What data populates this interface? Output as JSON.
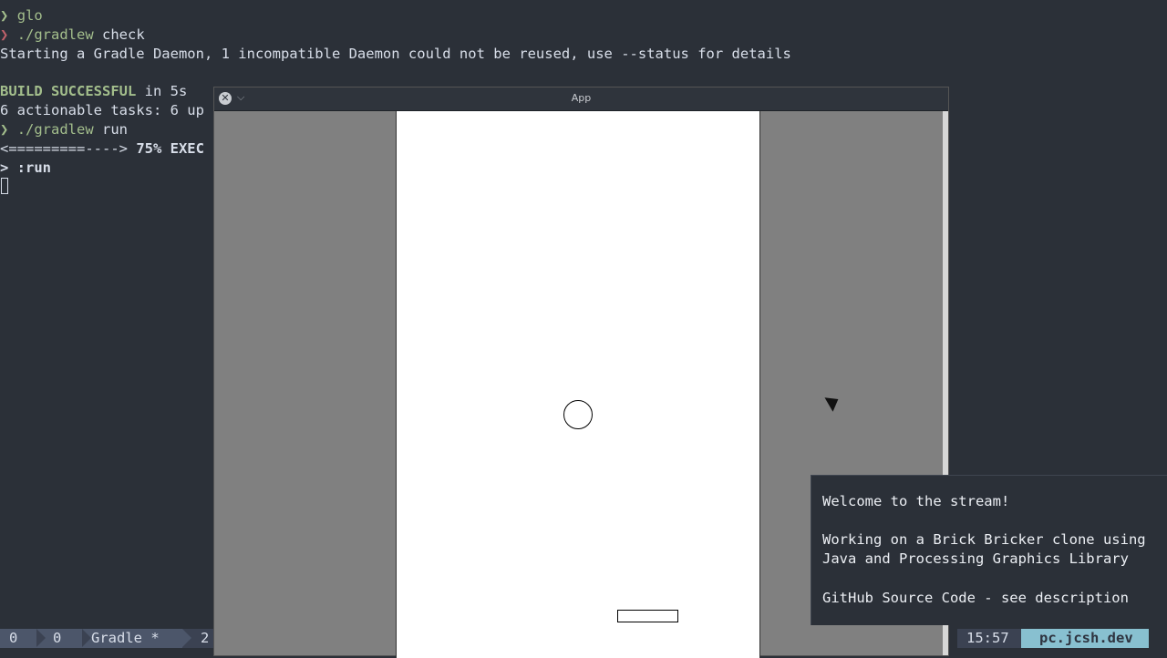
{
  "terminal": {
    "lines": [
      {
        "prompt": "❯",
        "cmd": "glo"
      },
      {
        "prompt": "❯",
        "cmd_path": "./gradlew",
        "cmd_arg": " check"
      },
      {
        "text": "Starting a Gradle Daemon, 1 incompatible Daemon could not be reused, use --status for details"
      },
      {
        "text": ""
      },
      {
        "bold": "BUILD SUCCESSFUL",
        "text": " in 5s"
      },
      {
        "text": "6 actionable tasks: 6 up"
      },
      {
        "prompt": "❯",
        "cmd_path": "./gradlew",
        "cmd_arg": " run"
      },
      {
        "progress_bar": "<=========---->",
        "progress_text": " 75% EXEC"
      },
      {
        "text": "> :run"
      }
    ]
  },
  "statusbar": {
    "left": [
      "0",
      "0",
      "Gradle *",
      "2"
    ],
    "time": "15:57",
    "host": "pc.jcsh.dev"
  },
  "app_window": {
    "title": "App",
    "close_glyph": "✕",
    "menu_glyph": "⌵"
  },
  "overlay": {
    "welcome": "Welcome to the stream!",
    "line1": "Working on a Brick Bricker clone using",
    "line2": "Java and Processing Graphics Library",
    "github": "GitHub Source Code - see description"
  },
  "colors": {
    "terminal_bg": "#2b3038",
    "prompt_ok": "#a3be8c",
    "prompt_err": "#bf616a",
    "host_accent": "#88c0d0"
  }
}
